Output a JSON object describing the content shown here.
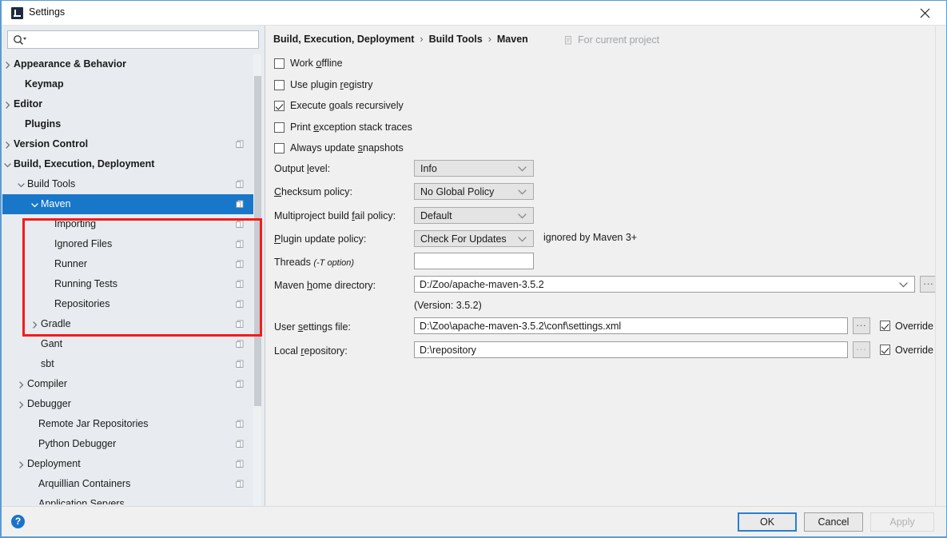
{
  "window": {
    "title": "Settings",
    "app_icon": "intellij-idea-icon",
    "close_icon": "close-icon"
  },
  "search": {
    "value": "",
    "placeholder": "",
    "icon": "search-icon",
    "dropdown_icon": "chevron-down-icon"
  },
  "sidebar": {
    "scrollbar": "vertical-scrollbar",
    "items": [
      {
        "label": "Appearance & Behavior",
        "indent": 14,
        "twisty": "chevron-right",
        "bold": true,
        "scope_icon": false,
        "selected": false
      },
      {
        "label": "Keymap",
        "indent": 28,
        "twisty": "none",
        "bold": true,
        "scope_icon": false,
        "selected": false
      },
      {
        "label": "Editor",
        "indent": 14,
        "twisty": "chevron-right",
        "bold": true,
        "scope_icon": false,
        "selected": false
      },
      {
        "label": "Plugins",
        "indent": 28,
        "twisty": "none",
        "bold": true,
        "scope_icon": false,
        "selected": false
      },
      {
        "label": "Version Control",
        "indent": 14,
        "twisty": "chevron-right",
        "bold": true,
        "scope_icon": true,
        "selected": false
      },
      {
        "label": "Build, Execution, Deployment",
        "indent": 14,
        "twisty": "chevron-down",
        "bold": true,
        "scope_icon": false,
        "selected": false
      },
      {
        "label": "Build Tools",
        "indent": 31,
        "twisty": "chevron-down",
        "bold": false,
        "scope_icon": true,
        "selected": false
      },
      {
        "label": "Maven",
        "indent": 48,
        "twisty": "chevron-down",
        "bold": false,
        "scope_icon": true,
        "selected": true
      },
      {
        "label": "Importing",
        "indent": 65,
        "twisty": "none",
        "bold": false,
        "scope_icon": true,
        "selected": false
      },
      {
        "label": "Ignored Files",
        "indent": 65,
        "twisty": "none",
        "bold": false,
        "scope_icon": true,
        "selected": false
      },
      {
        "label": "Runner",
        "indent": 65,
        "twisty": "none",
        "bold": false,
        "scope_icon": true,
        "selected": false
      },
      {
        "label": "Running Tests",
        "indent": 65,
        "twisty": "none",
        "bold": false,
        "scope_icon": true,
        "selected": false
      },
      {
        "label": "Repositories",
        "indent": 65,
        "twisty": "none",
        "bold": false,
        "scope_icon": true,
        "selected": false
      },
      {
        "label": "Gradle",
        "indent": 48,
        "twisty": "chevron-right",
        "bold": false,
        "scope_icon": true,
        "selected": false
      },
      {
        "label": "Gant",
        "indent": 48,
        "twisty": "none",
        "bold": false,
        "scope_icon": true,
        "selected": false
      },
      {
        "label": "sbt",
        "indent": 48,
        "twisty": "none",
        "bold": false,
        "scope_icon": true,
        "selected": false
      },
      {
        "label": "Compiler",
        "indent": 31,
        "twisty": "chevron-right",
        "bold": false,
        "scope_icon": true,
        "selected": false
      },
      {
        "label": "Debugger",
        "indent": 31,
        "twisty": "chevron-right",
        "bold": false,
        "scope_icon": false,
        "selected": false
      },
      {
        "label": "Remote Jar Repositories",
        "indent": 45,
        "twisty": "none",
        "bold": false,
        "scope_icon": true,
        "selected": false
      },
      {
        "label": "Python Debugger",
        "indent": 45,
        "twisty": "none",
        "bold": false,
        "scope_icon": true,
        "selected": false
      },
      {
        "label": "Deployment",
        "indent": 31,
        "twisty": "chevron-right",
        "bold": false,
        "scope_icon": true,
        "selected": false
      },
      {
        "label": "Arquillian Containers",
        "indent": 45,
        "twisty": "none",
        "bold": false,
        "scope_icon": true,
        "selected": false
      },
      {
        "label": "Application Servers",
        "indent": 45,
        "twisty": "none",
        "bold": false,
        "scope_icon": false,
        "selected": false
      }
    ]
  },
  "annotation": {
    "color": "#f41b1b",
    "shape": "rectangle-highlight"
  },
  "main": {
    "breadcrumb": [
      "Build, Execution, Deployment",
      "Build Tools",
      "Maven"
    ],
    "breadcrumb_separator": "›",
    "project_scope": {
      "label": "For current project",
      "icon": "project-scope-icon"
    },
    "checkboxes": [
      {
        "label_pre": "Work ",
        "label_key": "o",
        "label_post": "ffline",
        "checked": false
      },
      {
        "label_pre": "Use plugin ",
        "label_key": "r",
        "label_post": "egistry",
        "checked": false
      },
      {
        "label_pre": "Execute ",
        "label_key": "g",
        "label_post": "oals recursively",
        "checked": true
      },
      {
        "label_pre": "Print ",
        "label_key": "e",
        "label_post": "xception stack traces",
        "checked": false
      },
      {
        "label_pre": "Always update ",
        "label_key": "s",
        "label_post": "napshots",
        "checked": false
      }
    ],
    "combos": [
      {
        "label_pre": "Output ",
        "label_key": "l",
        "label_post": "evel:",
        "value": "Info",
        "note": ""
      },
      {
        "label_pre": "",
        "label_key": "C",
        "label_post": "hecksum policy:",
        "value": "No Global Policy",
        "note": ""
      },
      {
        "label_pre": "Multiproject build ",
        "label_key": "f",
        "label_post": "ail policy:",
        "value": "Default",
        "note": ""
      },
      {
        "label_pre": "",
        "label_key": "P",
        "label_post": "lugin update policy:",
        "value": "Check For Updates",
        "note": "ignored by Maven 3+"
      }
    ],
    "threads": {
      "label": "Threads",
      "label_italic": "(-T option)",
      "value": ""
    },
    "maven_home": {
      "label_pre": "Maven ",
      "label_key": "h",
      "label_post": "ome directory:",
      "value": "D:/Zoo/apache-maven-3.5.2",
      "browse_label": "...",
      "version_note": "(Version: 3.5.2)"
    },
    "user_settings": {
      "label_pre": "User ",
      "label_key": "s",
      "label_post": "ettings file:",
      "value": "D:\\Zoo\\apache-maven-3.5.2\\conf\\settings.xml",
      "browse_label": "...",
      "override_label": "Override",
      "override_checked": true
    },
    "local_repo": {
      "label_pre": "Local ",
      "label_key": "r",
      "label_post": "epository:",
      "value": "D:\\repository",
      "browse_label": "...",
      "override_label": "Override",
      "override_checked": true
    }
  },
  "footer": {
    "help_icon": "help-icon",
    "help_glyph": "?",
    "ok_label": "OK",
    "cancel_label": "Cancel",
    "apply_label": "Apply",
    "apply_disabled": true
  },
  "colors": {
    "selection_blue": "#1877c9",
    "annotation_red": "#f41b1b",
    "focus_blue": "#2a7fd4",
    "panel_bg": "#f0f0f0",
    "sidebar_bg": "#e8ecf0"
  }
}
